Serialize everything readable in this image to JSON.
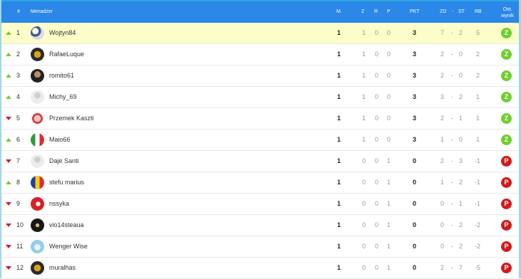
{
  "header": {
    "rank": "#",
    "manager": "Menadżer",
    "m": "M.",
    "z": "Z",
    "r": "R",
    "p": "P",
    "pkt": "PKT",
    "zd": "ZD",
    "st": "ST",
    "rb": "RB",
    "last1": "Ost.",
    "last2": "wynik"
  },
  "colors": {
    "header_bg": "#2b87e8",
    "highlight_row": "#fdfdc9",
    "win_badge": "#6fcf2f",
    "loss_badge": "#d01c1c"
  },
  "rows": [
    {
      "rank": "1",
      "trend": "up",
      "name": "Wojtyn84",
      "m": "1",
      "z": "1",
      "r": "0",
      "p": "0",
      "pkt": "3",
      "zd": "7",
      "st": "2",
      "rb": "5",
      "result": "Z",
      "avatar": "avatar-mixed"
    },
    {
      "rank": "2",
      "trend": "up",
      "name": "RafaeLuque",
      "m": "1",
      "z": "1",
      "r": "0",
      "p": "0",
      "pkt": "3",
      "zd": "2",
      "st": "0",
      "rb": "2",
      "result": "Z",
      "avatar": "avatar-crest"
    },
    {
      "rank": "3",
      "trend": "up",
      "name": "romito61",
      "m": "1",
      "z": "1",
      "r": "0",
      "p": "0",
      "pkt": "3",
      "zd": "2",
      "st": "0",
      "rb": "2",
      "result": "Z",
      "avatar": "avatar-person"
    },
    {
      "rank": "4",
      "trend": "up",
      "name": "Michy_69",
      "m": "1",
      "z": "1",
      "r": "0",
      "p": "0",
      "pkt": "3",
      "zd": "3",
      "st": "2",
      "rb": "1",
      "result": "Z",
      "avatar": "avatar-default"
    },
    {
      "rank": "5",
      "trend": "down",
      "name": "Przemek Kaszti",
      "m": "1",
      "z": "1",
      "r": "0",
      "p": "0",
      "pkt": "3",
      "zd": "2",
      "st": "1",
      "rb": "1",
      "result": "Z",
      "avatar": "avatar-red"
    },
    {
      "rank": "6",
      "trend": "up",
      "name": "Maio66",
      "m": "1",
      "z": "1",
      "r": "0",
      "p": "0",
      "pkt": "3",
      "zd": "1",
      "st": "0",
      "rb": "1",
      "result": "Z",
      "avatar": "avatar-italy"
    },
    {
      "rank": "7",
      "trend": "down",
      "name": "Daje Santi",
      "m": "1",
      "z": "0",
      "r": "0",
      "p": "1",
      "pkt": "0",
      "zd": "2",
      "st": "3",
      "rb": "-1",
      "result": "P",
      "avatar": "avatar-default"
    },
    {
      "rank": "8",
      "trend": "up",
      "name": "stefu marius",
      "m": "1",
      "z": "0",
      "r": "0",
      "p": "1",
      "pkt": "0",
      "zd": "1",
      "st": "2",
      "rb": "-1",
      "result": "P",
      "avatar": "avatar-romania"
    },
    {
      "rank": "9",
      "trend": "down",
      "name": "nssyka",
      "m": "1",
      "z": "0",
      "r": "0",
      "p": "1",
      "pkt": "0",
      "zd": "0",
      "st": "1",
      "rb": "-1",
      "result": "P",
      "avatar": "avatar-turkey"
    },
    {
      "rank": "10",
      "trend": "down",
      "name": "vio14steaua",
      "m": "1",
      "z": "0",
      "r": "0",
      "p": "1",
      "pkt": "0",
      "zd": "0",
      "st": "2",
      "rb": "-2",
      "result": "P",
      "avatar": "avatar-dark"
    },
    {
      "rank": "11",
      "trend": "down",
      "name": "Wenger Wise",
      "m": "1",
      "z": "0",
      "r": "0",
      "p": "1",
      "pkt": "0",
      "zd": "0",
      "st": "2",
      "rb": "-2",
      "result": "P",
      "avatar": "avatar-sky"
    },
    {
      "rank": "12",
      "trend": "down",
      "name": "muralhas",
      "m": "1",
      "z": "0",
      "r": "0",
      "p": "1",
      "pkt": "0",
      "zd": "2",
      "st": "7",
      "rb": "-5",
      "result": "P",
      "avatar": "avatar-crest"
    }
  ]
}
